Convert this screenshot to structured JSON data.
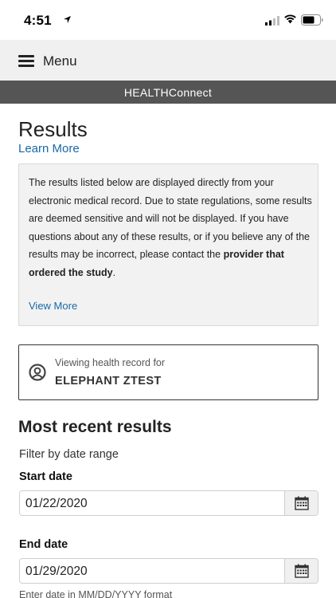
{
  "status_bar": {
    "time": "4:51"
  },
  "menu": {
    "label": "Menu"
  },
  "app_title": "HEALTHConnect",
  "page": {
    "title": "Results",
    "learn_more": "Learn More"
  },
  "notice": {
    "text_before": "The results listed below are displayed directly from your electronic medical record. Due to state regulations, some results are deemed sensitive and will not be displayed. If you have questions about any of these results, or if you believe any of the results may be incorrect, please contact the ",
    "text_bold": "provider that ordered the study",
    "text_after": ".",
    "view_more": "View More"
  },
  "viewing": {
    "label": "Viewing health record for",
    "name": "ELEPHANT ZTEST"
  },
  "results": {
    "section_title": "Most recent results",
    "filter_label": "Filter by date range",
    "start_label": "Start date",
    "start_value": "01/22/2020",
    "end_label": "End date",
    "end_value": "01/29/2020",
    "date_hint": "Enter date in MM/DD/YYYY format"
  },
  "icons": {
    "location": "location-arrow-icon",
    "signal": "cellular-signal-icon",
    "wifi": "wifi-icon",
    "battery": "battery-icon",
    "menu": "hamburger-menu-icon",
    "user": "user-circle-icon",
    "calendar": "calendar-icon"
  },
  "colors": {
    "link": "#1769aa",
    "title_bar": "#555555",
    "menu_bar": "#f1f0f0",
    "notice_bg": "#f3f2f2"
  }
}
